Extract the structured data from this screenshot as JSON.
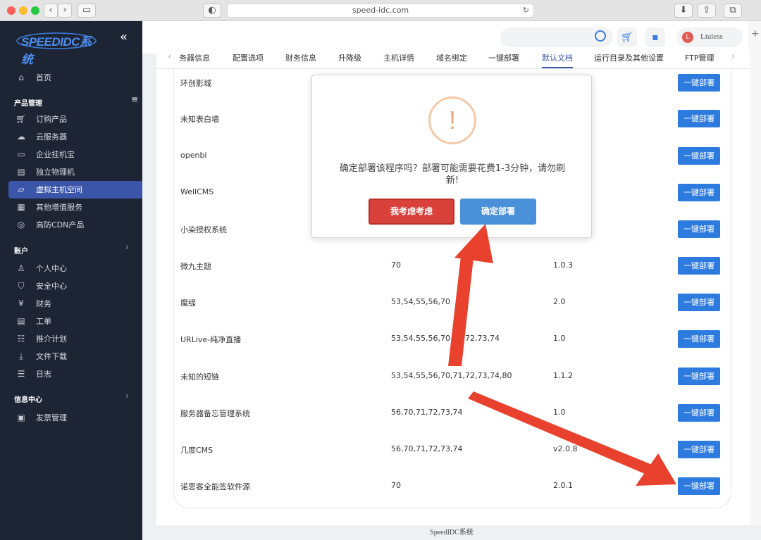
{
  "browser": {
    "url": "speed-idc.com"
  },
  "sidebar": {
    "logo": "SPEEDIDC系统",
    "collapse_icon": "«",
    "home": "首页",
    "section_products": "产品管理",
    "products": [
      {
        "label": "订购产品",
        "icon": "cart-icon"
      },
      {
        "label": "云服务器",
        "icon": "cloud-icon"
      },
      {
        "label": "企业挂机宝",
        "icon": "monitor-icon"
      },
      {
        "label": "独立物理机",
        "icon": "server-icon"
      },
      {
        "label": "虚拟主机空间",
        "icon": "folder-icon"
      },
      {
        "label": "其他增值服务",
        "icon": "grid-icon"
      },
      {
        "label": "高防CDN产品",
        "icon": "cdn-icon"
      }
    ],
    "section_account": "账户",
    "account": [
      {
        "label": "个人中心",
        "icon": "user-icon"
      },
      {
        "label": "安全中心",
        "icon": "shield-icon"
      },
      {
        "label": "财务",
        "icon": "finance-icon"
      },
      {
        "label": "工单",
        "icon": "ticket-icon"
      },
      {
        "label": "推介计划",
        "icon": "referral-icon"
      },
      {
        "label": "文件下载",
        "icon": "download-icon"
      },
      {
        "label": "日志",
        "icon": "log-icon"
      }
    ],
    "section_info": "信息中心",
    "info": [
      {
        "label": "发票管理",
        "icon": "invoice-icon"
      }
    ]
  },
  "header": {
    "username": "Liuless",
    "avatar_letter": "L"
  },
  "tabs": [
    "务器信息",
    "配置选项",
    "财务信息",
    "升降级",
    "主机详情",
    "域名绑定",
    "一键部署",
    "默认文档",
    "运行目录及其他设置",
    "FTP管理"
  ],
  "active_tab": "默认文档",
  "rows": [
    {
      "name": "环创影城",
      "versions": "",
      "ver": ""
    },
    {
      "name": "未知表白墙",
      "versions": "",
      "ver": ""
    },
    {
      "name": "openbi",
      "versions": "",
      "ver": ""
    },
    {
      "name": "WellCMS",
      "versions": "",
      "ver": ""
    },
    {
      "name": "小染授权系统",
      "versions": "",
      "ver": ""
    },
    {
      "name": "微九主题",
      "versions": "70",
      "ver": "1.0.3"
    },
    {
      "name": "魔缇",
      "versions": "53,54,55,56,70",
      "ver": "2.0"
    },
    {
      "name": "URLive-纯净直播",
      "versions": "53,54,55,56,70,71,72,73,74",
      "ver": "1.0"
    },
    {
      "name": "未知的短链",
      "versions": "53,54,55,56,70,71,72,73,74,80",
      "ver": "1.1.2"
    },
    {
      "name": "服务器备忘管理系统",
      "versions": "56,70,71,72,73,74",
      "ver": "1.0"
    },
    {
      "name": "几度CMS",
      "versions": "56,70,71,72,73,74",
      "ver": "v2.0.8"
    },
    {
      "name": "诺思客全能签软件源",
      "versions": "70",
      "ver": "2.0.1"
    }
  ],
  "deploy_label": "一键部署",
  "modal": {
    "icon": "!",
    "message": "确定部署该程序吗？部署可能需要花费1-3分钟，请勿刷新!",
    "cancel": "我考虑考虑",
    "confirm": "确定部署"
  },
  "footer": "SpeedIDC系统",
  "colors": {
    "sidebar_bg": "#1d2433",
    "active_item": "#3b55a8",
    "deploy_btn": "#2e7be0",
    "cancel_btn": "#d9413b",
    "confirm_btn": "#4a90d9",
    "annotation_arrow": "#e8422f"
  }
}
